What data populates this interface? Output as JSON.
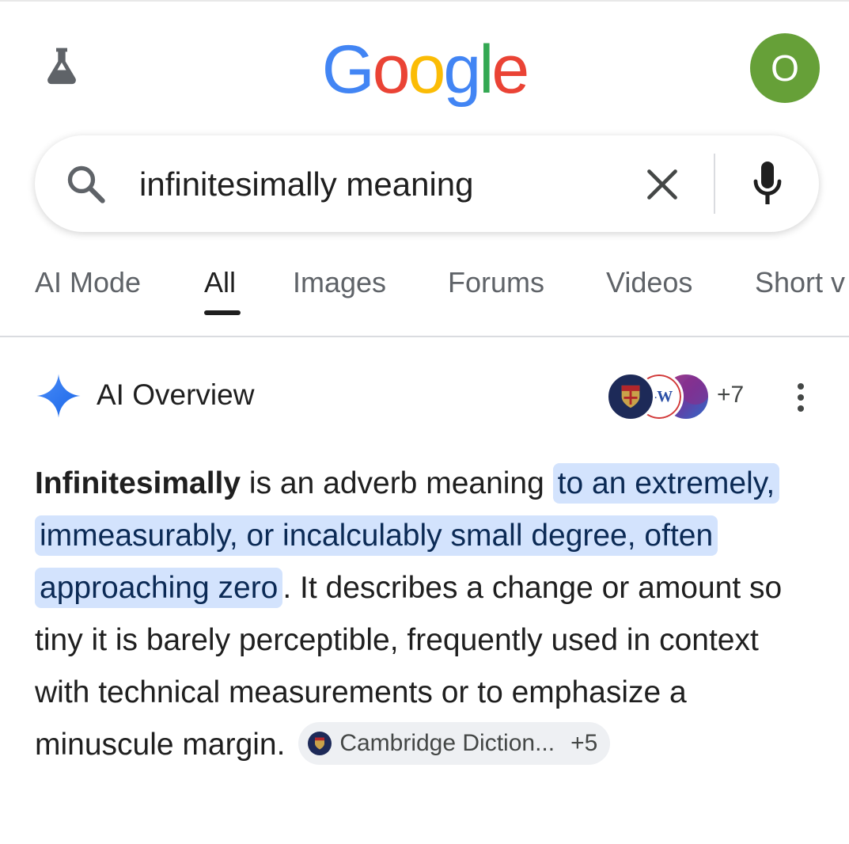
{
  "header": {
    "logo_letters": [
      {
        "ch": "G",
        "color": "#4285F4"
      },
      {
        "ch": "o",
        "color": "#EA4335"
      },
      {
        "ch": "o",
        "color": "#FBBC05"
      },
      {
        "ch": "g",
        "color": "#4285F4"
      },
      {
        "ch": "l",
        "color": "#34A853"
      },
      {
        "ch": "e",
        "color": "#EA4335"
      }
    ],
    "avatar_initial": "O",
    "avatar_color": "#66A038",
    "labs_icon": "flask-icon"
  },
  "search": {
    "query": "infinitesimally meaning",
    "icons": [
      "search-icon",
      "close-icon",
      "mic-icon"
    ]
  },
  "tabs": [
    {
      "label": "AI Mode",
      "active": false
    },
    {
      "label": "All",
      "active": true
    },
    {
      "label": "Images",
      "active": false
    },
    {
      "label": "Forums",
      "active": false
    },
    {
      "label": "Videos",
      "active": false
    },
    {
      "label": "Short v",
      "active": false
    }
  ],
  "ai_overview": {
    "title": "AI Overview",
    "sources_more": "+7",
    "source_badge_text": "I-W",
    "term": "Infinitesimally",
    "text_before_highlight": " is an adverb meaning ",
    "highlight": "to an extremely, immeasurably, or incalculably small degree, often approaching zero",
    "text_after_highlight": ". It describes a change or amount so tiny it is barely perceptible, frequently used in context with technical measurements or to emphasize a minuscule margin.",
    "citation": {
      "label": "Cambridge Diction...",
      "more": "+5"
    },
    "highlight_color": "#D3E3FD"
  }
}
